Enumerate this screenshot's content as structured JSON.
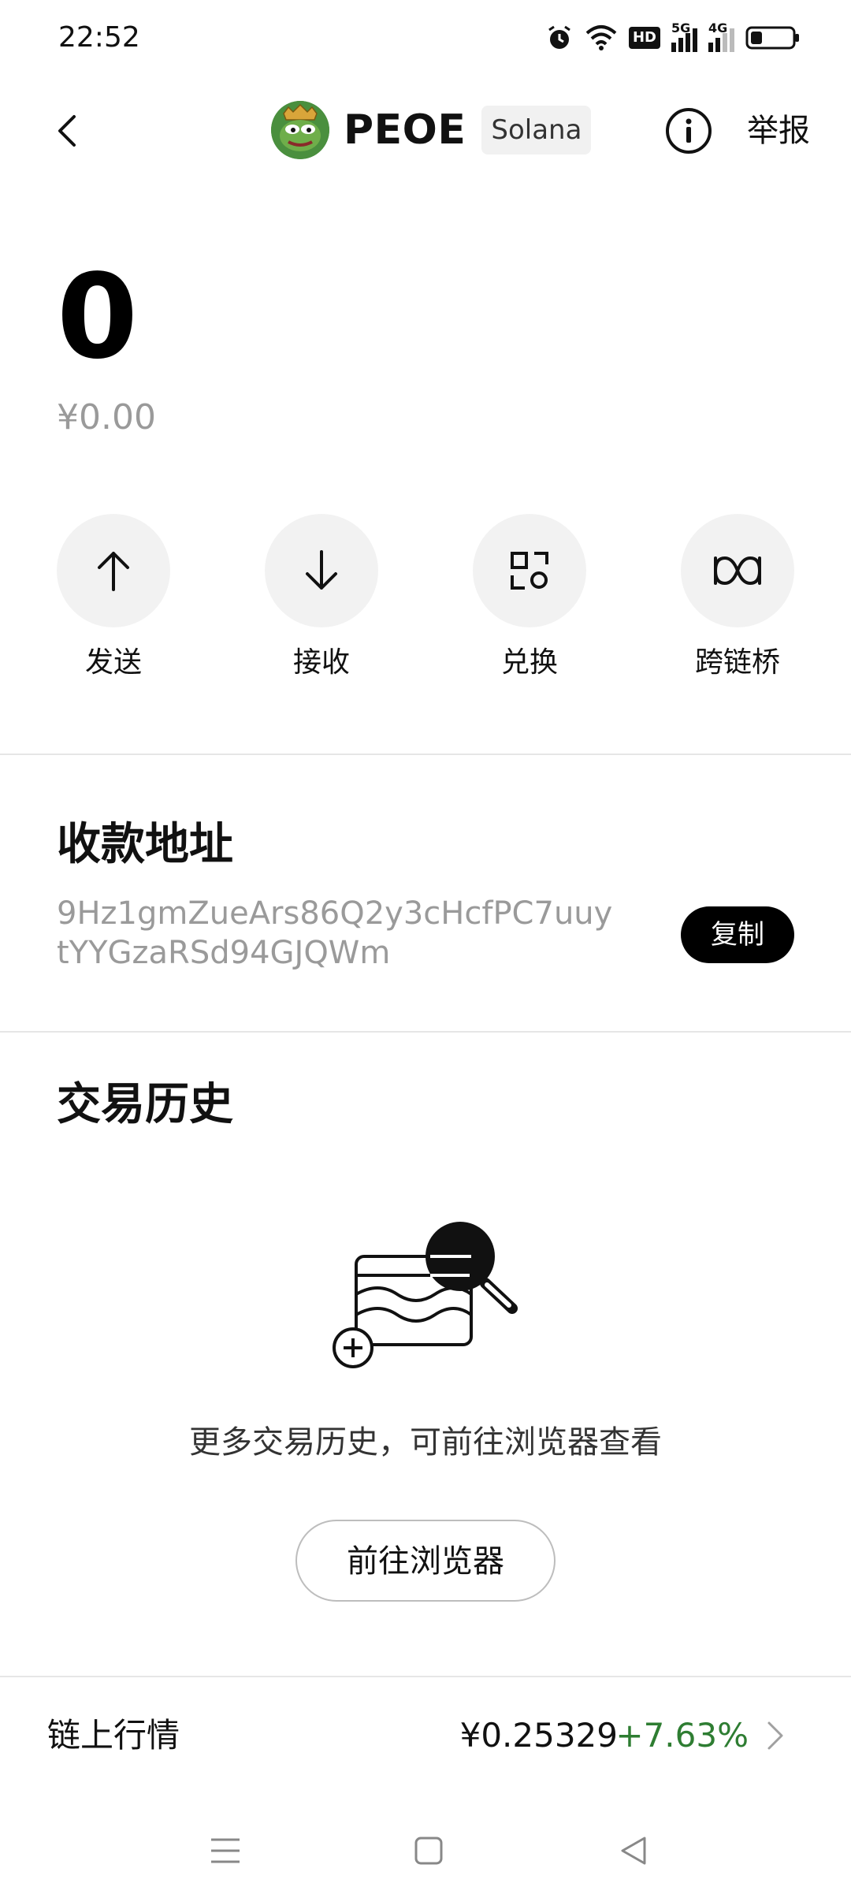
{
  "status_bar": {
    "time": "22:52",
    "icons": [
      "alarm-icon",
      "wifi-icon",
      "hd-icon",
      "5g-signal-icon",
      "4g-signal-icon",
      "battery-icon"
    ],
    "hd_label": "HD",
    "net_5g": "5G",
    "net_4g": "4G"
  },
  "header": {
    "token_symbol": "PEOE",
    "chain": "Solana",
    "report_label": "举报"
  },
  "balance": {
    "amount": "0",
    "fiat": "¥0.00"
  },
  "actions": [
    {
      "label": "发送",
      "icon": "arrow-up-icon"
    },
    {
      "label": "接收",
      "icon": "arrow-down-icon"
    },
    {
      "label": "兑换",
      "icon": "swap-icon"
    },
    {
      "label": "跨链桥",
      "icon": "bridge-icon"
    }
  ],
  "receive": {
    "title": "收款地址",
    "address": "9Hz1gmZueArs86Q2y3cHcfPC7uuytYYGzaRSd94GJQWm",
    "copy_label": "复制"
  },
  "history": {
    "title": "交易历史",
    "empty_text": "更多交易历史，可前往浏览器查看",
    "browser_button": "前往浏览器"
  },
  "market": {
    "label": "链上行情",
    "price": "¥0.25329",
    "change": "+7.63%"
  },
  "colors": {
    "accent": "#000000",
    "positive": "#2e7d32",
    "muted": "#9a9a9a",
    "circle_bg": "#f2f2f2"
  }
}
